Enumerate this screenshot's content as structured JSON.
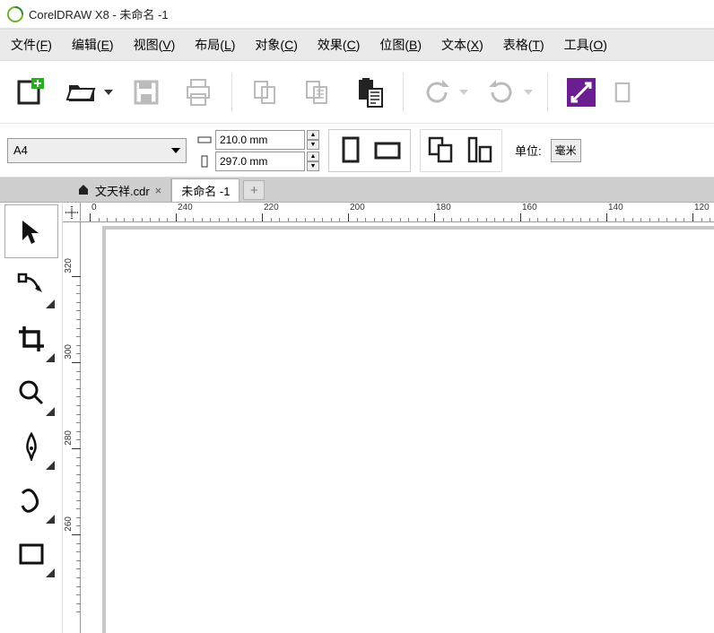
{
  "titlebar": {
    "app_name": "CorelDRAW X8",
    "separator": " - ",
    "doc_name": "未命名 -1"
  },
  "menubar": {
    "items": [
      {
        "label": "文件",
        "mnemonic": "F"
      },
      {
        "label": "编辑",
        "mnemonic": "E"
      },
      {
        "label": "视图",
        "mnemonic": "V"
      },
      {
        "label": "布局",
        "mnemonic": "L"
      },
      {
        "label": "对象",
        "mnemonic": "C"
      },
      {
        "label": "效果",
        "mnemonic": "C"
      },
      {
        "label": "位图",
        "mnemonic": "B"
      },
      {
        "label": "文本",
        "mnemonic": "X"
      },
      {
        "label": "表格",
        "mnemonic": "T"
      },
      {
        "label": "工具",
        "mnemonic": "O"
      }
    ]
  },
  "toolbar_standard": {
    "new_label": "新建",
    "open_label": "打开",
    "save_label": "保存",
    "print_label": "打印",
    "cut_label": "剪切",
    "copy_label": "复制",
    "paste_label": "粘贴",
    "undo_label": "撤销",
    "redo_label": "重做",
    "publish_label": "发布"
  },
  "property_bar": {
    "page_size_value": "A4",
    "width_label": "宽度",
    "height_label": "高度",
    "width_value": "210.0 mm",
    "height_value": "297.0 mm",
    "orientation_portrait": "纵向",
    "orientation_landscape": "横向",
    "unit_label": "单位:",
    "unit_value": "毫米"
  },
  "tabs": {
    "items": [
      {
        "label": "文天祥.cdr",
        "active": false,
        "has_home": true
      },
      {
        "label": "未命名 -1",
        "active": true,
        "has_home": false
      }
    ],
    "close_glyph": "×",
    "add_glyph": "+"
  },
  "toolbox": {
    "tools": [
      {
        "name": "pick-tool",
        "label": "选择工具",
        "active": true,
        "flyout": false
      },
      {
        "name": "shape-tool",
        "label": "形状工具",
        "active": false,
        "flyout": true
      },
      {
        "name": "crop-tool",
        "label": "裁剪工具",
        "active": false,
        "flyout": true
      },
      {
        "name": "zoom-tool",
        "label": "缩放工具",
        "active": false,
        "flyout": true
      },
      {
        "name": "pen-tool",
        "label": "钢笔工具",
        "active": false,
        "flyout": true
      },
      {
        "name": "artistic-media-tool",
        "label": "艺术笔工具",
        "active": false,
        "flyout": true
      },
      {
        "name": "rectangle-tool",
        "label": "矩形工具",
        "active": false,
        "flyout": true
      }
    ]
  },
  "ruler": {
    "h_labels": [
      "0",
      "240",
      "220",
      "200",
      "180",
      "160",
      "140",
      "120"
    ],
    "v_labels": [
      "320",
      "300",
      "280",
      "260"
    ]
  }
}
